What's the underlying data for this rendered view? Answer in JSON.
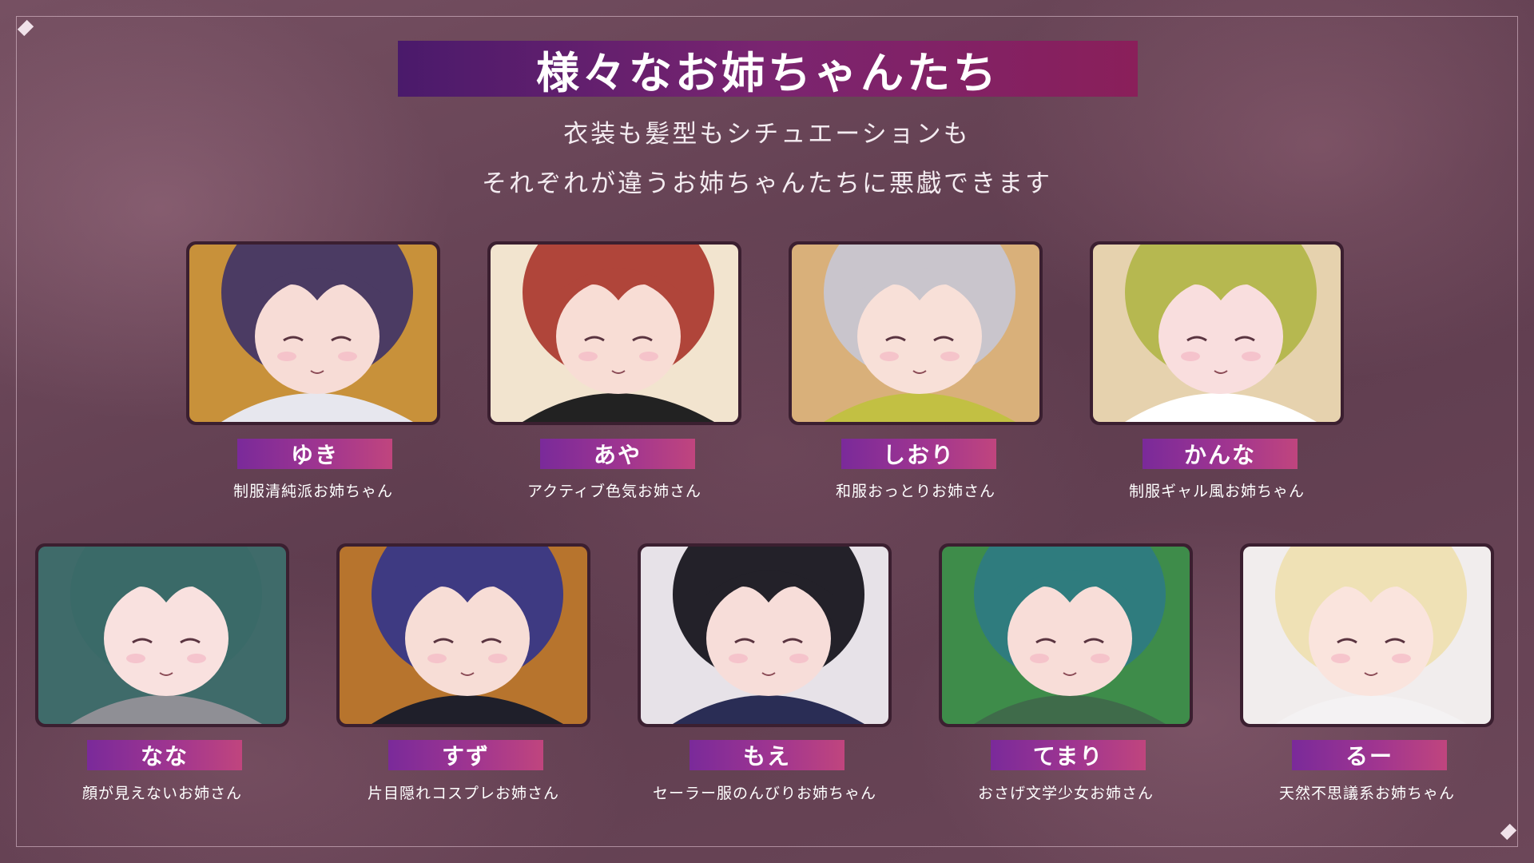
{
  "title": "様々なお姉ちゃんたち",
  "subtitle_line1": "衣装も髪型もシチュエーションも",
  "subtitle_line2": "それぞれが違うお姉ちゃんたちに悪戯できます",
  "characters_row1": [
    {
      "name": "ゆき",
      "desc": "制服清純派お姉ちゃん",
      "hair": "#4b3b63",
      "bg": "#c8913a",
      "skin": "#f7dcd6",
      "accent": "#e7e7ee"
    },
    {
      "name": "あや",
      "desc": "アクティブ色気お姉さん",
      "hair": "#b0453a",
      "bg": "#f2e4cf",
      "skin": "#f8ddd5",
      "accent": "#222222"
    },
    {
      "name": "しおり",
      "desc": "和服おっとりお姉さん",
      "hair": "#c9c5cc",
      "bg": "#d9b07a",
      "skin": "#f8e0d8",
      "accent": "#c2c043"
    },
    {
      "name": "かんな",
      "desc": "制服ギャル風お姉ちゃん",
      "hair": "#b6b850",
      "bg": "#e6d2ae",
      "skin": "#f9dede",
      "accent": "#ffffff"
    }
  ],
  "characters_row2": [
    {
      "name": "なな",
      "desc": "顔が見えないお姉さん",
      "hair": "#3a6a68",
      "bg": "#3f6b6a",
      "skin": "#f9e1df",
      "accent": "#8f8f95"
    },
    {
      "name": "すず",
      "desc": "片目隠れコスプレお姉さん",
      "hair": "#3e3a82",
      "bg": "#b7742d",
      "skin": "#f7ddd6",
      "accent": "#1f1f2a"
    },
    {
      "name": "もえ",
      "desc": "セーラー服のんびりお姉ちゃん",
      "hair": "#232129",
      "bg": "#e7e2e8",
      "skin": "#f7ddd9",
      "accent": "#2a2d55"
    },
    {
      "name": "てまり",
      "desc": "おさげ文学少女お姉さん",
      "hair": "#2f7c7e",
      "bg": "#3e8c4a",
      "skin": "#f8ddd8",
      "accent": "#3f6b4a"
    },
    {
      "name": "るー",
      "desc": "天然不思議系お姉ちゃん",
      "hair": "#efe1b5",
      "bg": "#f1eded",
      "skin": "#fae4dd",
      "accent": "#f4f2f3"
    }
  ]
}
